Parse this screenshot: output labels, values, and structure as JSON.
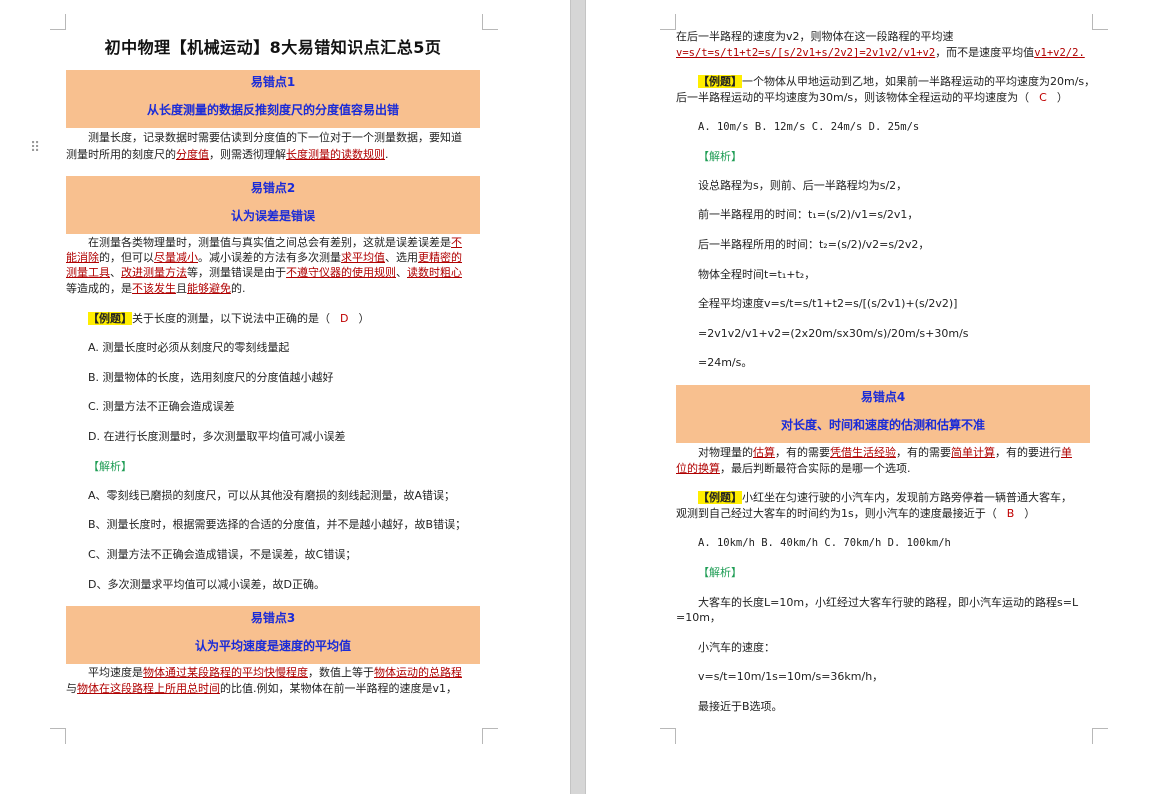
{
  "title": "初中物理【机械运动】8大易错知识点汇总5页",
  "drag_handle": "⠿",
  "points": [
    {
      "label": "易错点1",
      "heading": "从长度测量的数据反推刻度尺的分度值容易出错"
    },
    {
      "label": "易错点2",
      "heading": "认为误差是错误"
    },
    {
      "label": "易错点3",
      "heading": "认为平均速度是速度的平均值"
    },
    {
      "label": "易错点4",
      "heading": "对长度、时间和速度的估测和估算不准"
    }
  ],
  "p1": {
    "l1": "测量长度，记录数据时需要估读到分度值的下一位对于一个测量数据，要知道",
    "l2a": "测量时所用的刻度尺的",
    "l2b": "分度值",
    "l2c": "，则需透彻理解",
    "l2d": "长度测量的读数规则",
    "l2e": "."
  },
  "p2": {
    "l1a": "在测量各类物理量时，测量值与真实值之间总会有差别，这就是误差误差是",
    "l1b": "不",
    "l2a": "能消除",
    "l2b": "的，但可以",
    "l2c": "尽量减小",
    "l2d": "。减小误差的方法有多次测量",
    "l2e": "求平均值",
    "l2f": "、选用",
    "l2g": "更精密的",
    "l3a": "测量工具",
    "l3b": "、",
    "l3c": "改进测量方法",
    "l3d": "等，测量错误是由于",
    "l3e": "不遵守仪器的使用规则",
    "l3f": "、",
    "l3g": "读数时粗心",
    "l4a": "等造成的，是",
    "l4b": "不该发生",
    "l4c": "且",
    "l4d": "能够避免",
    "l4e": "的."
  },
  "q1": {
    "tag": "【例题】",
    "stem": "关于长度的测量，以下说法中正确的是（",
    "answer": "D",
    "close": "）",
    "options": [
      "A. 测量长度时必须从刻度尺的零刻线量起",
      "B. 测量物体的长度，选用刻度尺的分度值越小越好",
      "C. 测量方法不正确会造成误差",
      "D. 在进行长度测量时，多次测量取平均值可减小误差"
    ],
    "analysis_tag": "【解析】",
    "analysis": [
      "A、零刻线已磨损的刻度尺，可以从其他没有磨损的刻线起测量，故A错误；",
      "B、测量长度时，根据需要选择的合适的分度值，并不是越小越好，故B错误；",
      "C、测量方法不正确会造成错误，不是误差，故C错误；",
      "D、多次测量求平均值可以减小误差，故D正确。"
    ]
  },
  "p3": {
    "l1a": "平均速度是",
    "l1b": "物体通过某段路程的平均快慢程度",
    "l1c": "，数值上等于",
    "l1d": "物体运动的总路程",
    "l2a": "与",
    "l2b": "物体在这段路程上所用总时间",
    "l2c": "的比值.例如，某物体在前一半路程的速度是v1，"
  },
  "right_top": {
    "l1": "在后一半路程的速度为v2，则物体在这一段路程的平均速",
    "l2a": "v=s/t=s/t1+t2=s/[s/2v1+s/2v2]=2v1v2/v1+v2",
    "l2b": "，而不是速度平均值",
    "l2c": "v1+v2/2."
  },
  "q2": {
    "tag": "【例题】",
    "l1": "一个物体从甲地运动到乙地，如果前一半路程运动的平均速度为20m/s，",
    "l2a": "后一半路程运动的平均速度为30m/s，则该物体全程运动的平均速度为（",
    "answer": "C",
    "close": "）",
    "options": "A. 10m/s B. 12m/s C. 24m/s D. 25m/s",
    "analysis_tag": "【解析】",
    "steps": [
      "设总路程为s，则前、后一半路程均为s/2，",
      "前一半路程用的时间：t₁=(s/2)/v1=s/2v1，",
      "后一半路程所用的时间：t₂=(s/2)/v2=s/2v2，",
      "物体全程时间t=t₁+t₂，",
      "全程平均速度v=s/t=s/t1+t2=s/[(s/2v1)+(s/2v2)]",
      "=2v1v2/v1+v2=(2x20m/sx30m/s)/20m/s+30m/s",
      "=24m/s。"
    ]
  },
  "p4": {
    "l1a": "对物理量的",
    "l1b": "估算",
    "l1c": "，有的需要",
    "l1d": "凭借生活经验",
    "l1e": "，有的需要",
    "l1f": "简单计算",
    "l1g": "，有的要进行",
    "l1h": "单",
    "l2a": "位的换算",
    "l2b": "，最后判断最符合实际的是哪一个选项."
  },
  "q3": {
    "tag": "【例题】",
    "l1": "小红坐在匀速行驶的小汽车内，发现前方路旁停着一辆普通大客车，",
    "l2a": "观测到自己经过大客车的时间约为1s，则小汽车的速度最接近于（",
    "answer": "B",
    "close": "）",
    "options": "A. 10km/h B. 40km/h C. 70km/h D. 100km/h",
    "analysis_tag": "【解析】",
    "a1": "大客车的长度L=10m，小红经过大客车行驶的路程，即小汽车运动的路程s=L",
    "a2": "=10m，",
    "a3": "小汽车的速度：",
    "a4": "v=s/t=10m/1s=10m/s=36km/h，",
    "a5": "最接近于B选项。"
  }
}
